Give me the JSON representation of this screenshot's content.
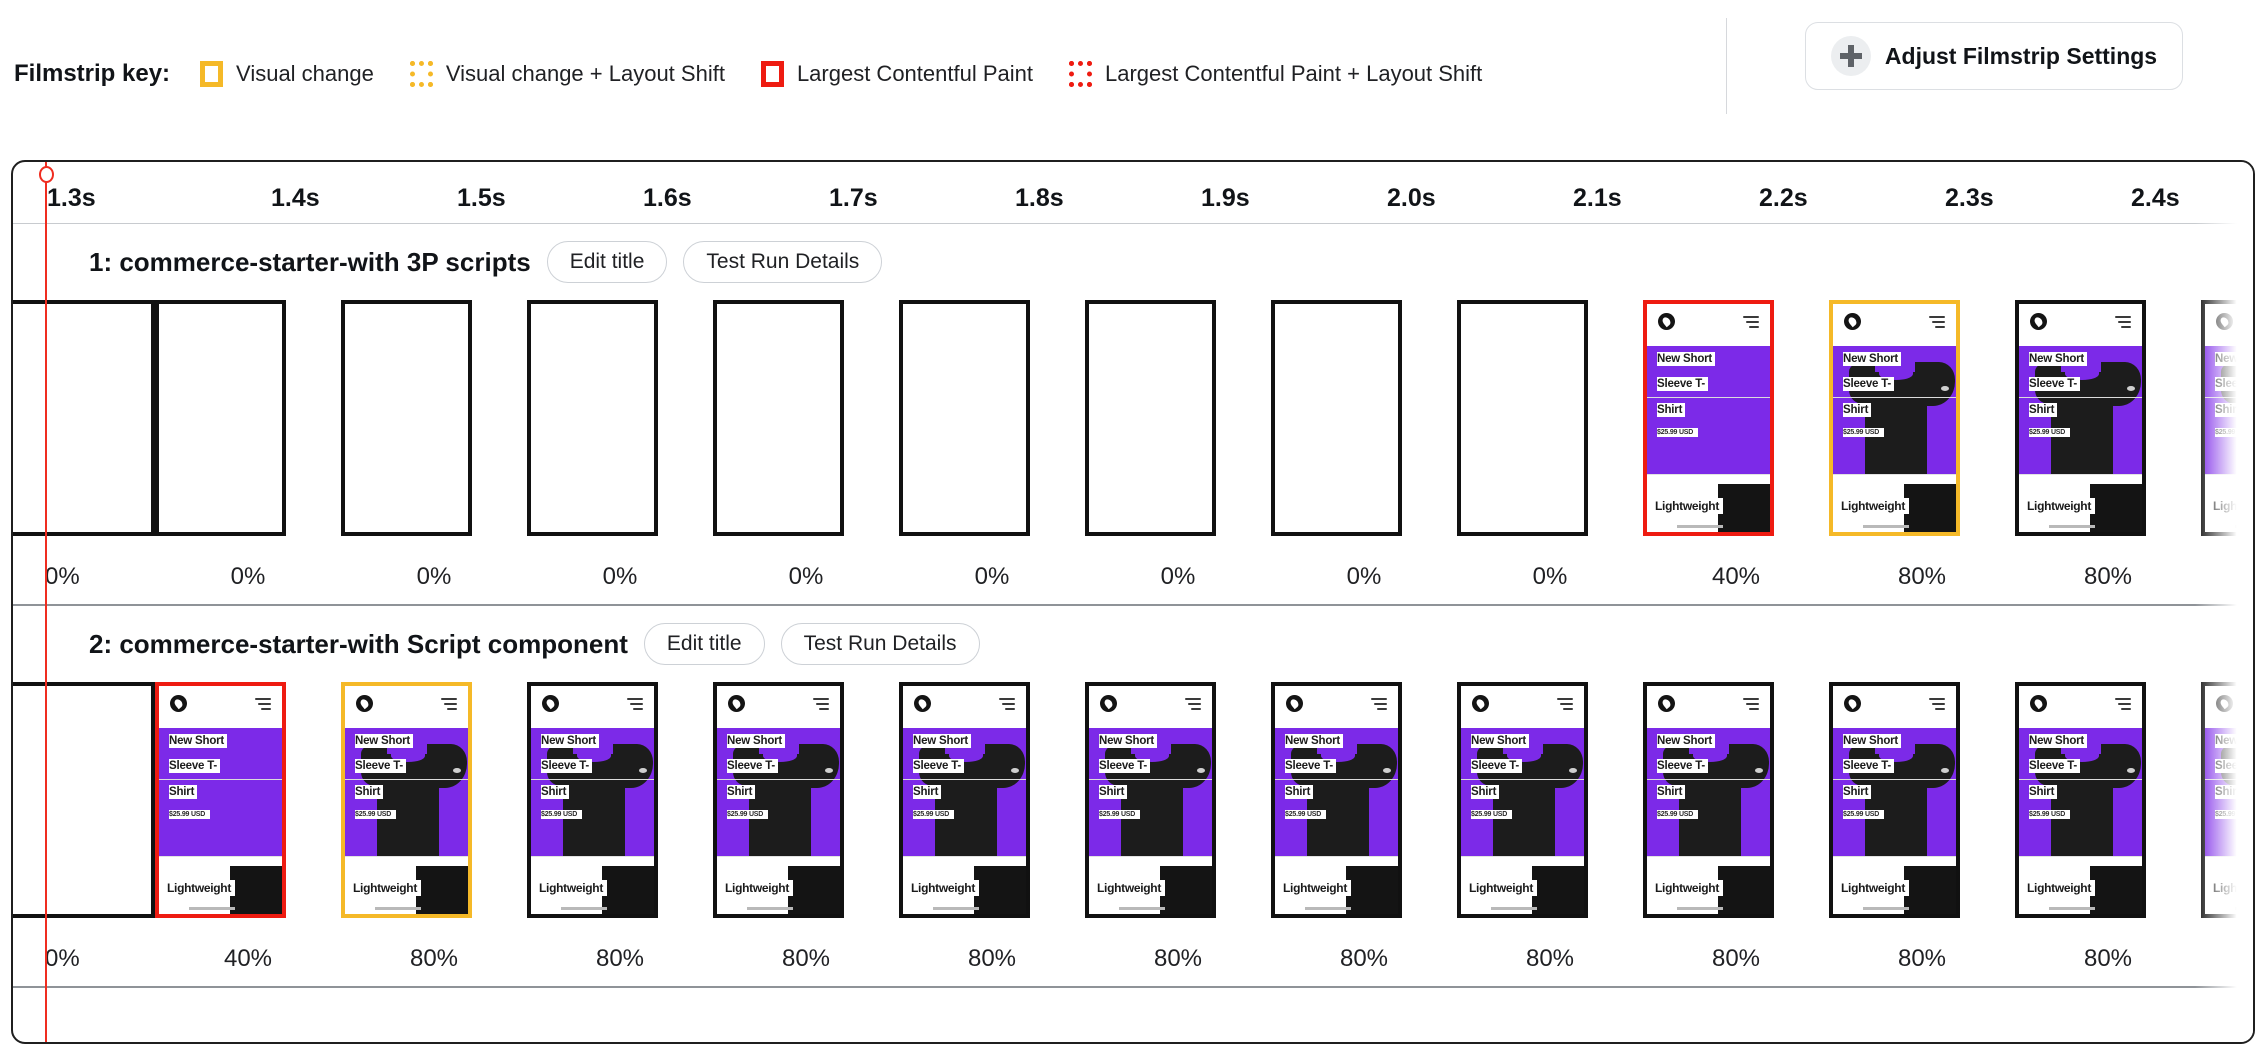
{
  "legend": {
    "title": "Filmstrip key:",
    "items": [
      {
        "label": "Visual change",
        "style": "solid",
        "color": "#F5B928",
        "icon": "square-outline-icon"
      },
      {
        "label": "Visual change + Layout Shift",
        "style": "dotted",
        "color": "#F5B928",
        "icon": "square-dotted-icon"
      },
      {
        "label": "Largest Contentful Paint",
        "style": "solid",
        "color": "#EE1B11",
        "icon": "square-outline-icon"
      },
      {
        "label": "Largest Contentful Paint + Layout Shift",
        "style": "dotted",
        "color": "#EE1B11",
        "icon": "square-dotted-icon"
      }
    ],
    "adjust_button": {
      "label": "Adjust Filmstrip Settings",
      "icon": "plus-icon"
    }
  },
  "timeline": {
    "ticks": [
      "1.3s",
      "1.4s",
      "1.5s",
      "1.6s",
      "1.7s",
      "1.8s",
      "1.9s",
      "2.0s",
      "2.1s",
      "2.2s",
      "2.3s",
      "2.4s"
    ],
    "playhead_label": "1.3s"
  },
  "thumbnail_content": {
    "line1": "New Short",
    "line2": "Sleeve T-",
    "line3": "Shirt",
    "price": "$25.99 USD",
    "footer": "Lightweight",
    "logo_icon": "brand-logo-icon",
    "menu_icon": "hamburger-menu-icon",
    "hero_color": "#7C2AE8"
  },
  "runs": [
    {
      "title": "1: commerce-starter-with 3P scripts",
      "edit_label": "Edit title",
      "details_label": "Test Run Details",
      "frames": [
        {
          "clipped": true,
          "border": "black",
          "state": "blank",
          "pct": "0%"
        },
        {
          "clipped": false,
          "border": "black",
          "state": "blank",
          "pct": "0%"
        },
        {
          "clipped": false,
          "border": "black",
          "state": "blank",
          "pct": "0%"
        },
        {
          "clipped": false,
          "border": "black",
          "state": "blank",
          "pct": "0%"
        },
        {
          "clipped": false,
          "border": "black",
          "state": "blank",
          "pct": "0%"
        },
        {
          "clipped": false,
          "border": "black",
          "state": "blank",
          "pct": "0%"
        },
        {
          "clipped": false,
          "border": "black",
          "state": "blank",
          "pct": "0%"
        },
        {
          "clipped": false,
          "border": "black",
          "state": "blank",
          "pct": "0%"
        },
        {
          "clipped": false,
          "border": "black",
          "state": "blank",
          "pct": "0%"
        },
        {
          "clipped": false,
          "border": "red",
          "state": "noshirt",
          "pct": "40%"
        },
        {
          "clipped": false,
          "border": "amber",
          "state": "shirt",
          "pct": "80%"
        },
        {
          "clipped": false,
          "border": "black",
          "state": "shirt",
          "pct": "80%"
        },
        {
          "clipped": false,
          "border": "black",
          "state": "shirt",
          "pct": ""
        }
      ]
    },
    {
      "title": "2: commerce-starter-with Script component",
      "edit_label": "Edit title",
      "details_label": "Test Run Details",
      "frames": [
        {
          "clipped": true,
          "border": "black",
          "state": "blank",
          "pct": "0%"
        },
        {
          "clipped": false,
          "border": "red",
          "state": "noshirt",
          "pct": "40%"
        },
        {
          "clipped": false,
          "border": "amber",
          "state": "shirt",
          "pct": "80%"
        },
        {
          "clipped": false,
          "border": "black",
          "state": "shirt",
          "pct": "80%"
        },
        {
          "clipped": false,
          "border": "black",
          "state": "shirt",
          "pct": "80%"
        },
        {
          "clipped": false,
          "border": "black",
          "state": "shirt",
          "pct": "80%"
        },
        {
          "clipped": false,
          "border": "black",
          "state": "shirt",
          "pct": "80%"
        },
        {
          "clipped": false,
          "border": "black",
          "state": "shirt",
          "pct": "80%"
        },
        {
          "clipped": false,
          "border": "black",
          "state": "shirt",
          "pct": "80%"
        },
        {
          "clipped": false,
          "border": "black",
          "state": "shirt",
          "pct": "80%"
        },
        {
          "clipped": false,
          "border": "black",
          "state": "shirt",
          "pct": "80%"
        },
        {
          "clipped": false,
          "border": "black",
          "state": "shirt",
          "pct": "80%"
        },
        {
          "clipped": false,
          "border": "black",
          "state": "shirt",
          "pct": ""
        }
      ]
    }
  ]
}
